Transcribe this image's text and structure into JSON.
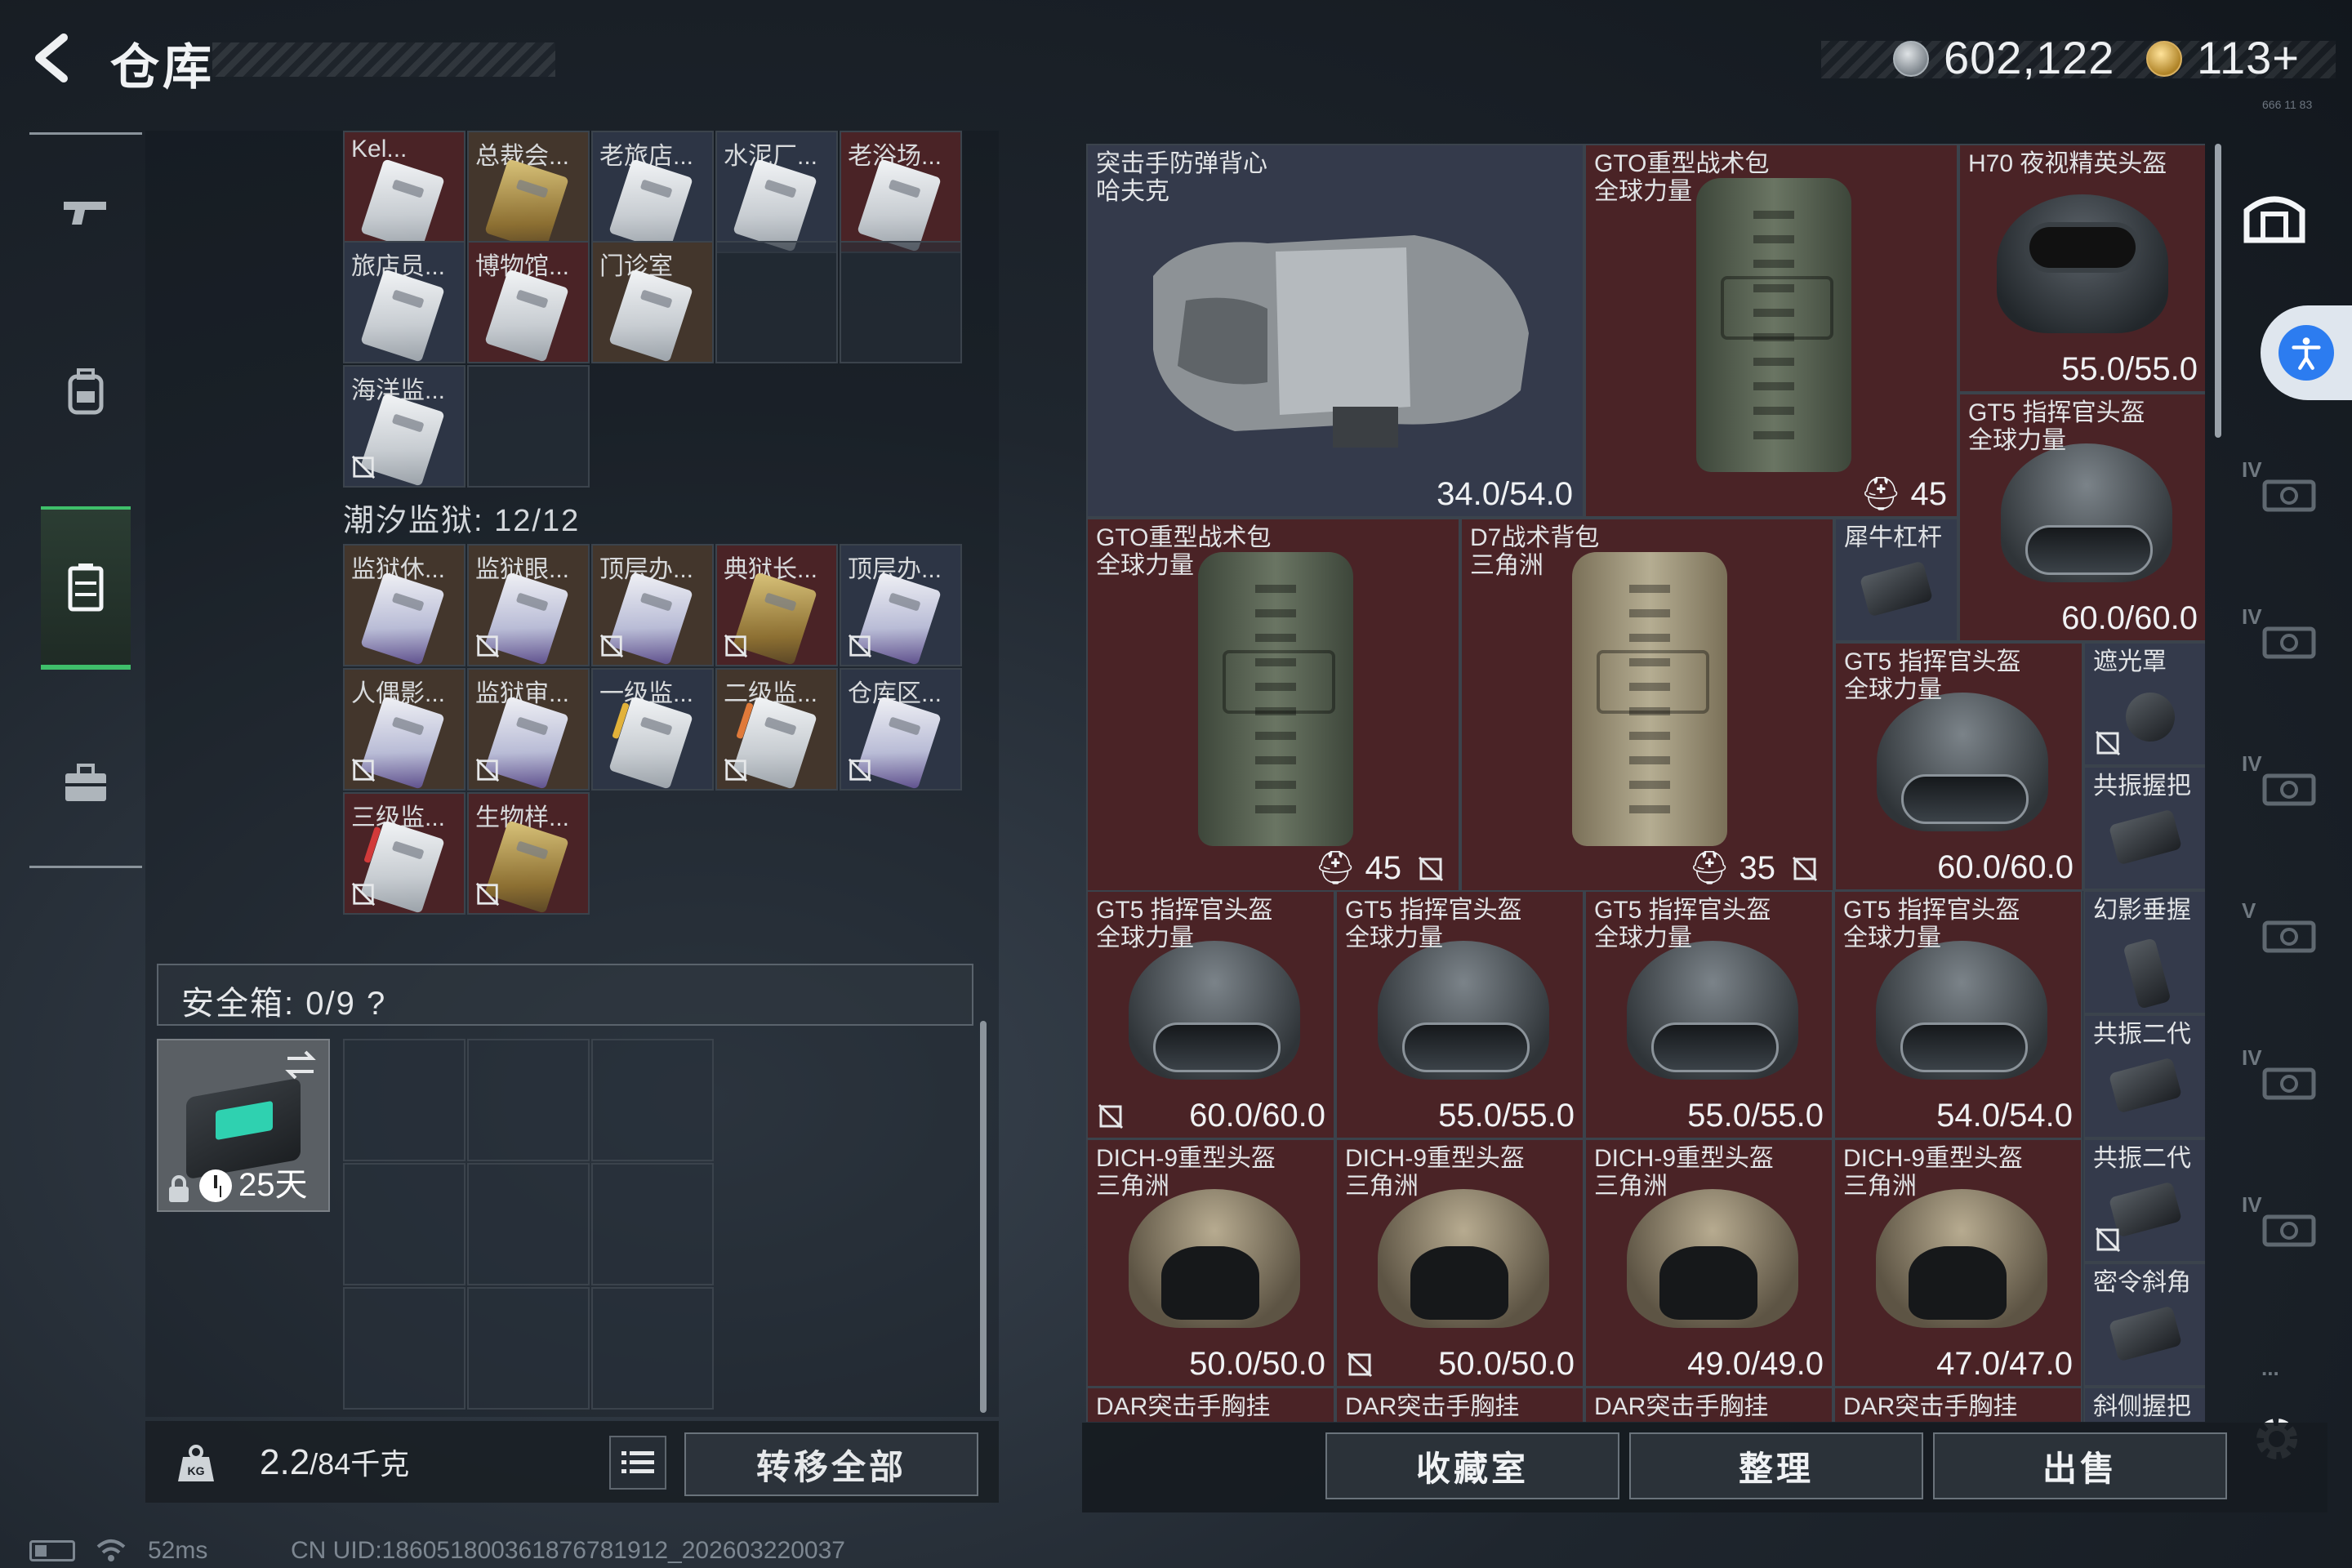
{
  "header": {
    "title": "仓库",
    "silver_amount": "602,122",
    "gold_amount": "113+",
    "tiny_code": "666 11 83"
  },
  "nav": {
    "items": [
      "weapons",
      "backpack",
      "storage",
      "toolbox"
    ],
    "active": "storage"
  },
  "storage": {
    "top_row": [
      {
        "label": "Kel...",
        "tone": "red",
        "card": "white"
      },
      {
        "label": "总裁会...",
        "tone": "brown",
        "card": "gold"
      },
      {
        "label": "老旅店...",
        "tone": "blue",
        "card": "white"
      },
      {
        "label": "水泥厂...",
        "tone": "blue",
        "card": "white"
      },
      {
        "label": "老浴场...",
        "tone": "red",
        "card": "white"
      }
    ],
    "row2": [
      {
        "label": "旅店员...",
        "tone": "blue",
        "card": "white"
      },
      {
        "label": "博物馆...",
        "tone": "red",
        "card": "white"
      },
      {
        "label": "门诊室",
        "tone": "brown",
        "card": "white"
      }
    ],
    "row3": [
      {
        "label": "海洋监...",
        "tone": "blue",
        "card": "white",
        "noshare": true
      }
    ],
    "prison_label": "潮汐监狱: 12/12",
    "prison_rows": [
      [
        {
          "label": "监狱休...",
          "tone": "brown",
          "card": "purple",
          "noshare": false
        },
        {
          "label": "监狱眼...",
          "tone": "brown",
          "card": "purple",
          "noshare": true
        },
        {
          "label": "顶层办...",
          "tone": "brown",
          "card": "purple",
          "noshare": true
        },
        {
          "label": "典狱长...",
          "tone": "red",
          "card": "gold",
          "noshare": true
        },
        {
          "label": "顶层办...",
          "tone": "blue",
          "card": "purple",
          "noshare": true
        }
      ],
      [
        {
          "label": "人偶影...",
          "tone": "brown",
          "card": "purple",
          "noshare": true
        },
        {
          "label": "监狱审...",
          "tone": "brown",
          "card": "purple",
          "noshare": true
        },
        {
          "label": "一级监...",
          "tone": "blue",
          "card": "white",
          "noshare": false,
          "stripe": "#e2b23a"
        },
        {
          "label": "二级监...",
          "tone": "brown",
          "card": "white",
          "noshare": true,
          "stripe": "#e07a3a"
        },
        {
          "label": "仓库区...",
          "tone": "blue",
          "card": "purple",
          "noshare": true
        }
      ],
      [
        {
          "label": "三级监...",
          "tone": "red",
          "card": "white",
          "noshare": true,
          "stripe": "#d23a3a"
        },
        {
          "label": "生物样...",
          "tone": "red",
          "card": "gold",
          "noshare": true
        }
      ]
    ]
  },
  "safebox": {
    "label": "安全箱: 0/9",
    "help": "?",
    "days": "25天"
  },
  "footer_left": {
    "weight": "2.2",
    "weight_max": "/84千克",
    "transfer_all": "转移全部"
  },
  "status": {
    "ping": "52ms",
    "uid": "CN UID:186051800361876781912_202603220037"
  },
  "stash": {
    "vest": {
      "name_line1": "突击手防弹背心",
      "name_line2": "哈夫克",
      "durability": "34.0/54.0"
    },
    "gto_top": {
      "name_line1": "GTO重型战术包",
      "name_line2": "全球力量",
      "count": "45"
    },
    "h70": {
      "name_line1": "H70 夜视精英头盔",
      "durability": "55.0/55.0"
    },
    "gt5_top": {
      "name_line1": "GT5 指挥官头盔",
      "name_line2": "全球力量",
      "durability": "60.0/60.0"
    },
    "gto_mid": {
      "name_line1": "GTO重型战术包",
      "name_line2": "全球力量",
      "count": "45"
    },
    "d7": {
      "name_line1": "D7战术背包",
      "name_line2": "三角洲",
      "count": "35"
    },
    "rhino": {
      "name_line1": "犀牛杠杆"
    },
    "gt5_mid": {
      "name_line1": "GT5 指挥官头盔",
      "name_line2": "全球力量",
      "durability": "60.0/60.0"
    },
    "shade": {
      "name_line1": "遮光罩"
    },
    "grip1": {
      "name_line1": "共振握把"
    },
    "gt5_row": [
      {
        "name_line1": "GT5 指挥官头盔",
        "name_line2": "全球力量",
        "durability": "60.0/60.0"
      },
      {
        "name_line1": "GT5 指挥官头盔",
        "name_line2": "全球力量",
        "durability": "55.0/55.0"
      },
      {
        "name_line1": "GT5 指挥官头盔",
        "name_line2": "全球力量",
        "durability": "55.0/55.0"
      },
      {
        "name_line1": "GT5 指挥官头盔",
        "name_line2": "全球力量",
        "durability": "54.0/54.0"
      }
    ],
    "phantom": {
      "name_line1": "幻影垂握"
    },
    "resonance2a": {
      "name_line1": "共振二代"
    },
    "dich_row": [
      {
        "name_line1": "DICH-9重型头盔",
        "name_line2": "三角洲",
        "durability": "50.0/50.0"
      },
      {
        "name_line1": "DICH-9重型头盔",
        "name_line2": "三角洲",
        "durability": "50.0/50.0"
      },
      {
        "name_line1": "DICH-9重型头盔",
        "name_line2": "三角洲",
        "durability": "49.0/49.0"
      },
      {
        "name_line1": "DICH-9重型头盔",
        "name_line2": "三角洲",
        "durability": "47.0/47.0"
      }
    ],
    "resonance2b": {
      "name_line1": "共振二代"
    },
    "command": {
      "name_line1": "密令斜角"
    },
    "dar_row": [
      "DAR突击手胸挂",
      "DAR突击手胸挂",
      "DAR突击手胸挂",
      "DAR突击手胸挂"
    ],
    "side_grip": "斜侧握把"
  },
  "rail": {
    "tags": [
      "IV",
      "IV",
      "IV",
      "V",
      "IV",
      "IV",
      "IV",
      "..."
    ]
  },
  "footer_right": {
    "collection": "收藏室",
    "organize": "整理",
    "sell": "出售"
  },
  "colors": {
    "accent_green": "#3fbf6a",
    "rare_red": "#4a2326",
    "common_blue": "#343a4b",
    "access_blue": "#2c7cf0"
  }
}
